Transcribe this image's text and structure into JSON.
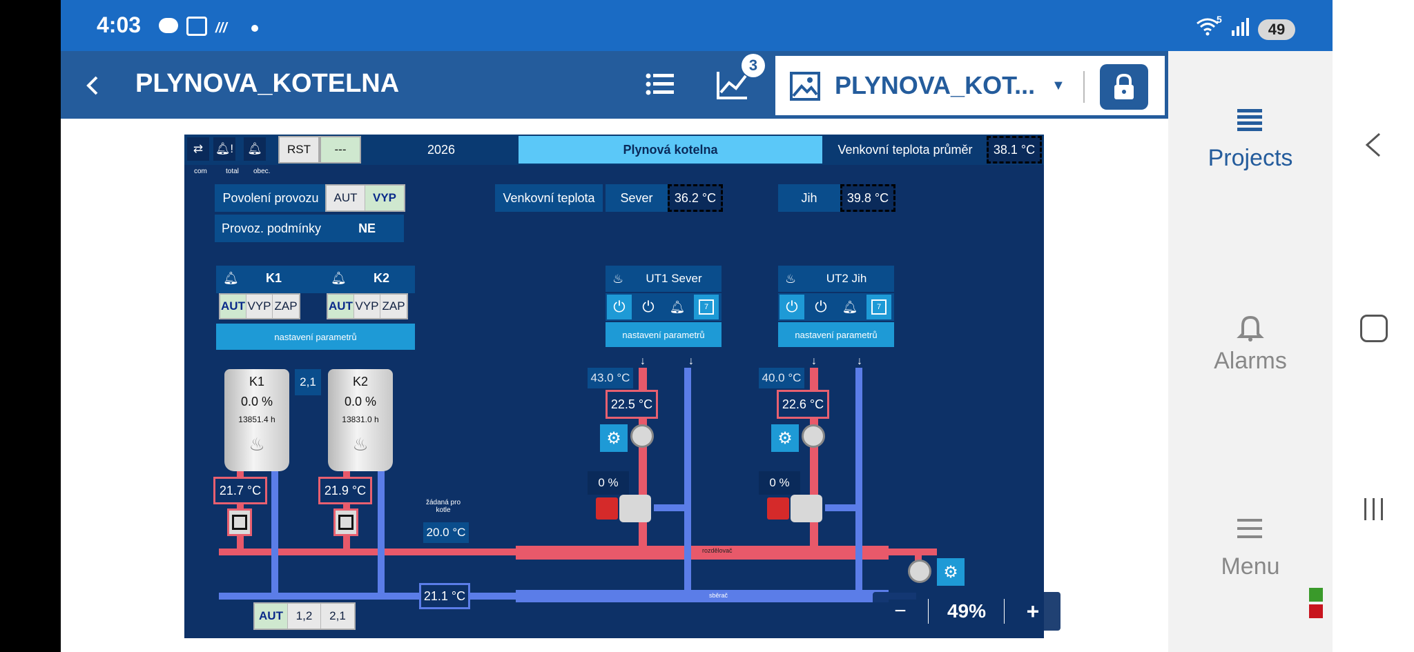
{
  "status_bar": {
    "time": "4:03",
    "battery": "49",
    "signal_5g": "5"
  },
  "app_bar": {
    "title": "PLYNOVA_KOTELNA",
    "chart_badge": "3",
    "project_select": "PLYNOVA_KOT..."
  },
  "side_panel": {
    "projects": "Projects",
    "alarms": "Alarms",
    "menu": "Menu"
  },
  "scada": {
    "top": {
      "com_label": "com",
      "total_label": "total",
      "obec_label": "obec.",
      "rst": "RST",
      "rst_value": "---",
      "year": "2026",
      "title": "Plynová kotelna",
      "avg_label": "Venkovní teplota průměr",
      "avg_value": "38.1 °C"
    },
    "enable": {
      "label": "Povolení provozu",
      "aut": "AUT",
      "vyp": "VYP",
      "cond_label": "Provoz. podmínky",
      "cond_value": "NE"
    },
    "outdoor": {
      "label": "Venkovní teplota",
      "north": "Sever",
      "north_value": "36.2 °C",
      "south": "Jih",
      "south_value": "39.8 °C"
    },
    "k1": {
      "name": "K1",
      "aut": "AUT",
      "vyp": "VYP",
      "zap": "ZAP",
      "percent": "0.0 %",
      "hours": "13851.4 h",
      "temp": "21.7 °C"
    },
    "k2": {
      "name": "K2",
      "aut": "AUT",
      "vyp": "VYP",
      "zap": "ZAP",
      "percent": "0.0 %",
      "hours": "13831.0 h",
      "temp": "21.9 °C"
    },
    "boiler_params": "nastavení parametrů",
    "seq_value": "2,1",
    "setpoint_label_1": "žádaná pro",
    "setpoint_label_2": "kotle",
    "setpoint_value": "20.0 °C",
    "return_temp": "21.1 °C",
    "distributor": "rozdělovač",
    "collector": "sběrač",
    "bottom_mode": {
      "aut": "AUT",
      "a": "1,2",
      "b": "2,1"
    },
    "ut1": {
      "name": "UT1 Sever",
      "params": "nastavení parametrů",
      "set_temp": "43.0 °C",
      "temp": "22.5 °C",
      "valve": "0 %"
    },
    "ut2": {
      "name": "UT2 Jih",
      "params": "nastavení parametrů",
      "set_temp": "40.0 °C",
      "temp": "22.6 °C",
      "valve": "0 %"
    },
    "calendar_day": "7"
  },
  "zoom": {
    "minus": "−",
    "value": "49%",
    "plus": "+"
  },
  "colors": {
    "status_bar": "#1a6bc4",
    "app_bar": "#245c9c",
    "scada_bg": "#0d3167",
    "hot_pipe": "#e8596a",
    "cold_pipe": "#5b7de8",
    "accent_blue": "#1e9ad6"
  }
}
